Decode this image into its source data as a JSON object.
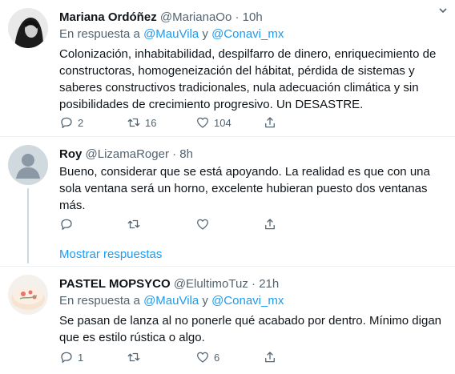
{
  "tweets": [
    {
      "name": "Mariana Ordóñez",
      "handle": "@MarianaOo",
      "time": "10h",
      "reply_prefix": "En respuesta a",
      "reply_user1": "@MauVila",
      "reply_and": "y",
      "reply_user2": "@Conavi_mx",
      "text": "Colonización, inhabitabilidad, despilfarro de dinero, enriquecimiento de constructoras, homogeneización del hábitat, pérdida de sistemas y saberes constructivos tradicionales, nula adecuación climática y sin posibilidades de crecimiento progresivo. Un DESASTRE.",
      "replies": "2",
      "retweets": "16",
      "likes": "104"
    },
    {
      "name": "Roy",
      "handle": "@LizamaRoger",
      "time": "8h",
      "text": "Bueno, considerar que se está apoyando. La realidad es que con una sola ventana será un horno, excelente hubieran puesto dos ventanas más.",
      "replies": "",
      "retweets": "",
      "likes": ""
    },
    {
      "name": "PASTEL MOPSYCO",
      "handle": "@ElultimoTuz",
      "time": "21h",
      "reply_prefix": "En respuesta a",
      "reply_user1": "@MauVila",
      "reply_and": "y",
      "reply_user2": "@Conavi_mx",
      "text": "Se pasan de lanza al no ponerle qué acabado por dentro. Mínimo digan que es estilo rústica o algo.",
      "replies": "1",
      "retweets": "",
      "likes": "6"
    }
  ],
  "show_more": "Mostrar respuestas",
  "icons": {
    "reply": "reply-icon",
    "retweet": "retweet-icon",
    "like": "like-icon",
    "share": "share-icon",
    "more": "chevron-down-icon"
  }
}
